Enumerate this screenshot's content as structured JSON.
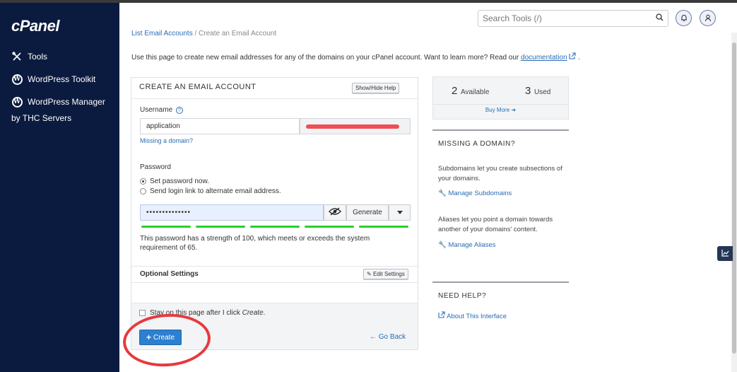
{
  "sidebar": {
    "logo": "cPanel",
    "items": [
      {
        "label": "Tools",
        "icon": "tools-icon"
      },
      {
        "label": "WordPress Toolkit",
        "icon": "wordpress-icon"
      },
      {
        "label": "WordPress Manager",
        "sublabel": "by THC Servers",
        "icon": "wordpress-icon"
      }
    ]
  },
  "header": {
    "search_placeholder": "Search Tools (/)"
  },
  "breadcrumb": {
    "parent": "List Email Accounts",
    "separator": "/",
    "current": "Create an Email Account"
  },
  "intro": {
    "text": "Use this page to create new email addresses for any of the domains on your cPanel account. Want to learn more? Read our",
    "link": "documentation",
    "tail": "."
  },
  "form": {
    "title": "CREATE AN EMAIL ACCOUNT",
    "help_toggle": "Show/Hide Help",
    "username_label": "Username",
    "username_value": "application",
    "missing_domain_link": "Missing a domain?",
    "password_label": "Password",
    "radio_set_now": "Set password now.",
    "radio_send_link": "Send login link to alternate email address.",
    "password_value": "••••••••••••••",
    "generate_label": "Generate",
    "strength_percent": 100,
    "strength_text": "This password has a strength of 100, which meets or exceeds the system requirement of 65.",
    "optional_settings_label": "Optional Settings",
    "edit_settings_label": "Edit Settings",
    "stay_checkbox_prefix": "Stay on this page after I click ",
    "stay_checkbox_em": "Create",
    "stay_checkbox_suffix": ".",
    "create_label": "Create",
    "go_back_label": "Go Back"
  },
  "stats": {
    "available_count": "2",
    "available_label": "Available",
    "used_count": "3",
    "used_label": "Used",
    "buy_more": "Buy More"
  },
  "missing_domain": {
    "title": "MISSING A DOMAIN?",
    "sub_text": "Subdomains let you create subsections of your domains.",
    "sub_link": "Manage Subdomains",
    "alias_text": "Aliases let you point a domain towards another of your domains' content.",
    "alias_link": "Manage Aliases"
  },
  "need_help": {
    "title": "NEED HELP?",
    "link": "About This Interface"
  },
  "colors": {
    "sidebar_bg": "#0b1b3f",
    "primary": "#2d7fcf",
    "link": "#2a6db3",
    "strength": "#27d12c",
    "annotation": "#e8393e"
  }
}
